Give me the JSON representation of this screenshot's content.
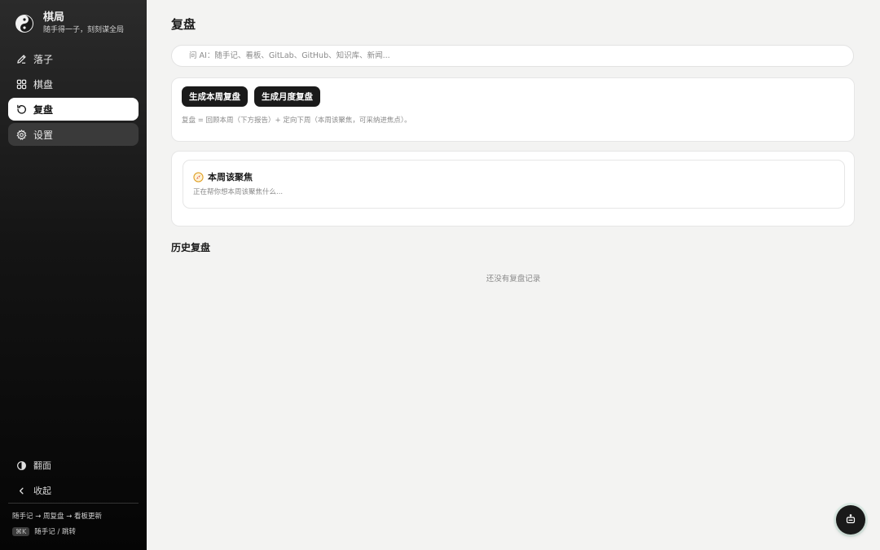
{
  "brand": {
    "title": "棋局",
    "subtitle": "随手得一子，刻刻谋全局"
  },
  "nav": {
    "items": [
      {
        "label": "落子",
        "icon": "pencil-icon"
      },
      {
        "label": "棋盘",
        "icon": "grid-icon"
      },
      {
        "label": "复盘",
        "icon": "rotate-icon",
        "active": true
      },
      {
        "label": "设置",
        "icon": "gear-icon"
      }
    ],
    "bottom": [
      {
        "label": "翻面",
        "icon": "contrast-icon"
      },
      {
        "label": "收起",
        "icon": "chevron-left-icon"
      }
    ]
  },
  "hint": {
    "flow": "随手记 → 周复盘 → 看板更新",
    "kbd": "⌘K",
    "kbd_desc": "随手记 / 跳转"
  },
  "page": {
    "title": "复盘"
  },
  "ask": {
    "placeholder": "问 AI：随手记、看板、GitLab、GitHub、知识库、新闻..."
  },
  "actions": {
    "weekly_label": "生成本周复盘",
    "monthly_label": "生成月度复盘",
    "note": "复盘 = 回顾本周（下方报告）+ 定向下周（本周该聚焦，可采纳进焦点）。"
  },
  "focus": {
    "title": "本周该聚焦",
    "status": "正在帮你想本周该聚焦什么..."
  },
  "history": {
    "title": "历史复盘",
    "empty": "还没有复盘记录"
  },
  "fab": {
    "icon": "robot-icon"
  },
  "colors": {
    "sidebar_bg": "#141414",
    "accent": "#1a1a1a",
    "page_bg": "#f3f3f2"
  }
}
